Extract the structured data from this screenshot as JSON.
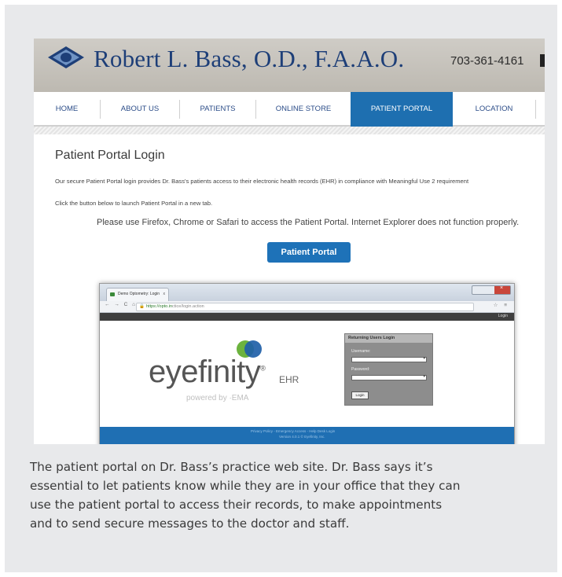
{
  "site": {
    "title": "Robert L. Bass, O.D., F.A.A.O.",
    "phone": "703-361-4161",
    "brand_color": "#1e3f78",
    "accent_color": "#1e6fb0"
  },
  "nav": {
    "items": [
      {
        "label": "HOME"
      },
      {
        "label": "ABOUT US"
      },
      {
        "label": "PATIENTS"
      },
      {
        "label": "ONLINE STORE"
      },
      {
        "label": "PATIENT PORTAL",
        "active": true
      },
      {
        "label": "LOCATION"
      }
    ]
  },
  "portal": {
    "heading": "Patient Portal Login",
    "text1": "Our secure Patient Portal login provides Dr. Bass's patients access to their electronic health records (EHR) in compliance with Meaningful Use 2 requirement",
    "text2": "Click the button below to launch Patient Portal in a new tab.",
    "note": "Please use Firefox, Chrome or Safari to access the Patient Portal.  Internet Explorer does not function properly.",
    "button_label": "Patient Portal"
  },
  "browser": {
    "tab_title": "Demo Optometry: Login",
    "tab_close": "x",
    "nav_glyphs": "← → C ⌂",
    "url_prefix": "https://opto.in",
    "url_suffix": "ctice/login.action",
    "addr_icons": "☆ ≡",
    "login_link": "Login",
    "brand_word": "eyefinity",
    "brand_mark": "®",
    "ehr_label": "EHR",
    "powered_by": "powered by ·EMA",
    "login_box": {
      "heading": "Returning Users Login",
      "username_label": "Username:",
      "password_label": "Password:",
      "button_label": "Login"
    },
    "footer_line1": "Privacy Policy - Emergency Access - Help Desk Login",
    "footer_line2": "Version 4.0.1 © Eyefinity, Inc."
  },
  "caption": {
    "lines": [
      "The patient portal on Dr. Bass’s practice web site. Dr. Bass says it’s",
      "essential to let patients know while they are in your office that they can",
      "use the patient portal to access their records, to make appointments",
      "and to send secure messages to the doctor and staff."
    ]
  }
}
